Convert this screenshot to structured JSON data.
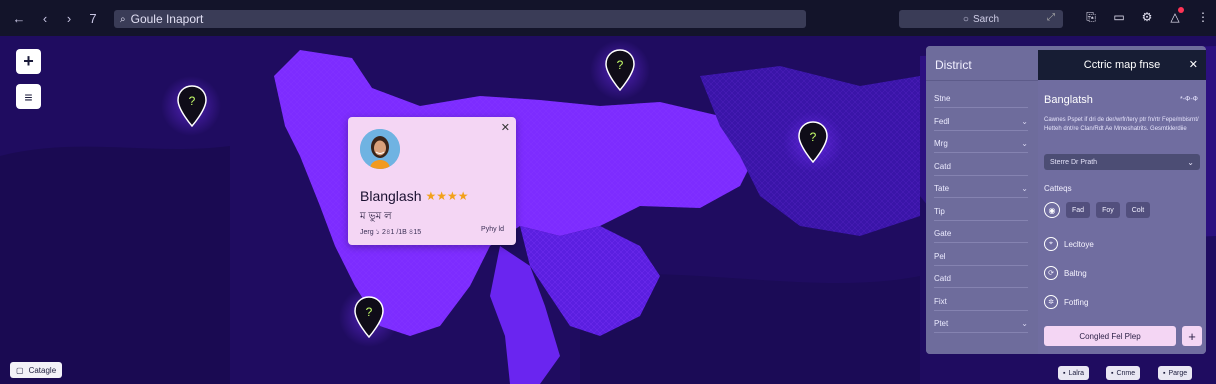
{
  "topbar": {
    "nav": {
      "back": "←",
      "forward_disabled": "‹",
      "forward": "›",
      "seven": "7",
      "more": "⁞"
    },
    "url": "Goule Inaport",
    "search_placeholder": "Sarch",
    "icons": [
      "share-icon",
      "chat-icon",
      "puzzle-icon",
      "notification-icon",
      "more-icon"
    ]
  },
  "map_controls": {
    "zoom_in": "+",
    "layers": "≡"
  },
  "popup": {
    "title": "Blanglash",
    "stars": "★★★★",
    "subtitle": "ম ভুম ল",
    "meta": "Jerg ১ 2৪1 /1B ৪15",
    "link": "Pyhy ld",
    "close": "✕"
  },
  "panel": {
    "left_header": "District",
    "fields": [
      {
        "label": "Stne",
        "chev": false
      },
      {
        "label": "Fedl",
        "chev": true
      },
      {
        "label": "Mrg",
        "chev": true
      },
      {
        "label": "Catd",
        "chev": false
      },
      {
        "label": "Tate",
        "chev": true
      },
      {
        "label": "Tip",
        "chev": false
      },
      {
        "label": "Gate",
        "chev": false
      },
      {
        "label": "Pel",
        "chev": false
      },
      {
        "label": "Catd",
        "chev": false
      },
      {
        "label": "Fixt",
        "chev": false
      },
      {
        "label": "Ptet",
        "chev": true
      }
    ],
    "right_header": "Cctric map fnse",
    "close": "✕",
    "region_title": "Banglatsh",
    "region_rank": "*-Ф-Ф",
    "region_desc": "Cawnes Pspet if dri de der/wrfr/tery ptr fn/rtr Fepe/mbisrnt/ Hetteh dnt/re Clan/Rdt Ae Mmeshatrits. Gesmtklerdiie",
    "select_value": "Sterre Dr Prath",
    "section_label": "Catteqs",
    "chips": [
      "Fad",
      "Foy",
      "Colt"
    ],
    "options": [
      "Lecltoye",
      "Baltng",
      "Fotfing"
    ],
    "cta": "Congled Fel Plep",
    "cta_plus": "+"
  },
  "bottom_left": "Catagle",
  "bottom_right": [
    "Lalra",
    "Cnme",
    "Parge"
  ]
}
